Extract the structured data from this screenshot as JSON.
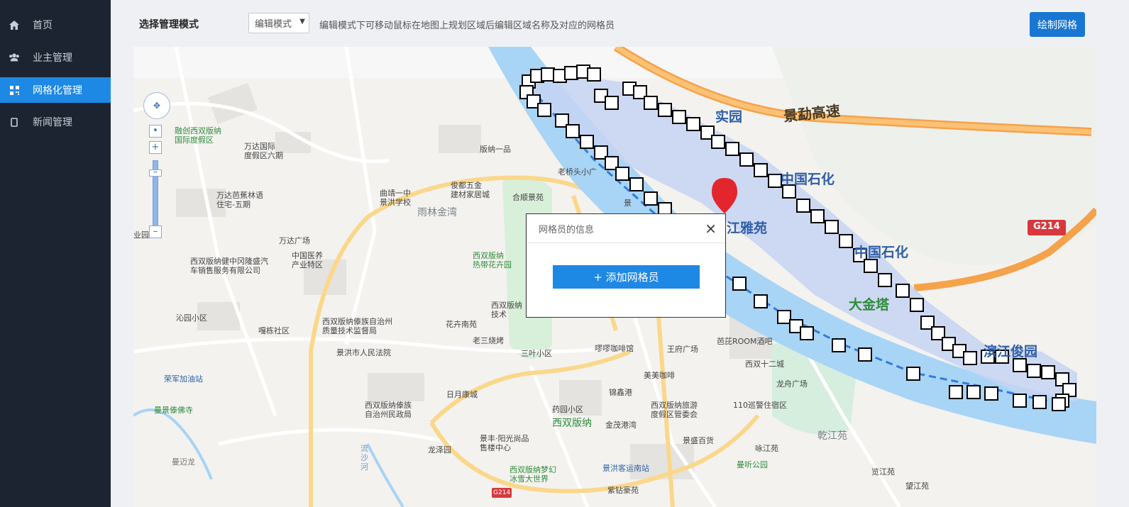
{
  "sidebar": {
    "items": [
      {
        "label": "首页",
        "icon": "home-icon"
      },
      {
        "label": "业主管理",
        "icon": "users-icon"
      },
      {
        "label": "网格化管理",
        "icon": "qrcode-icon",
        "active": true
      },
      {
        "label": "新闻管理",
        "icon": "tablet-icon"
      }
    ]
  },
  "toolbar": {
    "label": "选择管理模式",
    "mode_value": "编辑模式",
    "hint": "编辑模式下可移动鼠标在地图上规划区域后编辑区域名称及对应的网格员",
    "draw_button": "绘制网格"
  },
  "modal": {
    "title": "网格员的信息",
    "close": "×",
    "add_button": "+ 添加网格员"
  },
  "map": {
    "pois": [
      {
        "text": "融创西双版纳\n国际度假区",
        "cls": "green"
      },
      {
        "text": "万达国际\n度假区六期"
      },
      {
        "text": "万达芭蕉林语\n住宅-五期"
      },
      {
        "text": "版纳一品"
      },
      {
        "text": "曲靖一中\n景洪学校"
      },
      {
        "text": "俊都五金\n建材家居城"
      },
      {
        "text": "老桥头小广"
      },
      {
        "text": "合顺景苑"
      },
      {
        "text": "景"
      },
      {
        "text": "雨林金湾",
        "cls": "big"
      },
      {
        "text": "万达广场"
      },
      {
        "text": "中国医养\n产业特区"
      },
      {
        "text": "西双版纳健中冈隆盛汽\n车销售服务有限公司"
      },
      {
        "text": "西双版纳\n热带花卉园",
        "cls": "green"
      },
      {
        "text": "沁园小区"
      },
      {
        "text": "嘎栋社区"
      },
      {
        "text": "西双版纳傣族自治州\n质量技术监督局"
      },
      {
        "text": "景洪市人民法院"
      },
      {
        "text": "花卉南苑"
      },
      {
        "text": "西双版纳\n技术"
      },
      {
        "text": "老三烧烤"
      },
      {
        "text": "三叶小区"
      },
      {
        "text": "嘐嘐咖啡馆"
      },
      {
        "text": "王府广场"
      },
      {
        "text": "芭芘ROOM酒吧"
      },
      {
        "text": "西双十二城"
      },
      {
        "text": "龙舟广场"
      },
      {
        "text": "美美咖啡"
      },
      {
        "text": "锦鑫港"
      },
      {
        "text": "荣军加油站",
        "cls": "blue-s"
      },
      {
        "text": "曼景傣佛寺",
        "cls": "green"
      },
      {
        "text": "西双版纳傣族\n自治州民政局"
      },
      {
        "text": "日月康城"
      },
      {
        "text": "药园小区"
      },
      {
        "text": "金茂港湾"
      },
      {
        "text": "西双版纳旅游\n度假区管委会"
      },
      {
        "text": "110巡警住宿区"
      },
      {
        "text": "西双版纳",
        "cls": "greenbig"
      },
      {
        "text": "景丰·阳光尚品\n售楼中心"
      },
      {
        "text": "龙泽园"
      },
      {
        "text": "景盛百货"
      },
      {
        "text": "咏江苑"
      },
      {
        "text": "乾江苑",
        "cls": "big"
      },
      {
        "text": "流沙\n河",
        "cls": "river"
      },
      {
        "text": "曼迈龙"
      },
      {
        "text": "西双版纳梦幻\n冰雪大世界",
        "cls": "green"
      },
      {
        "text": "景洪客运南站",
        "cls": "bluetext"
      },
      {
        "text": "曼听公园",
        "cls": "green"
      },
      {
        "text": "览江苑"
      },
      {
        "text": "望江苑"
      },
      {
        "text": "紫钻豪苑"
      },
      {
        "text": "景勐高速",
        "cls": "road"
      },
      {
        "text": "中国石化",
        "cls": "blue"
      },
      {
        "text": "中国石化",
        "cls": "blue"
      },
      {
        "text": "江雅苑",
        "cls": "blue"
      },
      {
        "text": "大金塔",
        "cls": "greenbig2"
      },
      {
        "text": "滨江俊园",
        "cls": "blue"
      },
      {
        "text": "实园",
        "cls": "blue"
      },
      {
        "text": "G214",
        "cls": "shield"
      },
      {
        "text": "G214",
        "cls": "shield-s"
      },
      {
        "text": "业园区",
        "cls": ""
      }
    ]
  },
  "colors": {
    "sidebar_bg": "#1c2431",
    "active": "#1e88e5",
    "river": "#a8d4f5",
    "grid_fill": "#c6d4f2",
    "highway": "#f6a24a"
  }
}
